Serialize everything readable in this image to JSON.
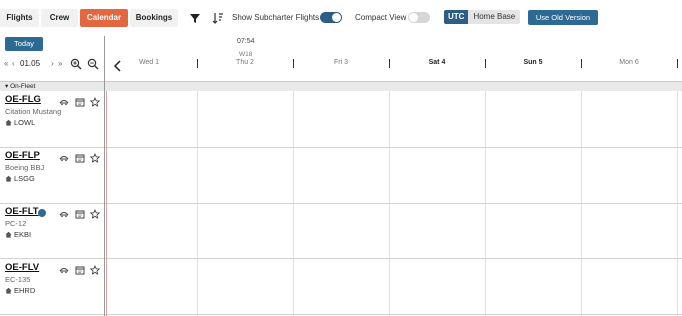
{
  "toolbar": {
    "tabs": [
      {
        "label": "Flights",
        "active": false
      },
      {
        "label": "Crew",
        "active": false
      },
      {
        "label": "Calendar",
        "active": true
      },
      {
        "label": "Bookings",
        "active": false
      }
    ],
    "filter_icon": "filter-icon",
    "sort_icon": "sort-icon",
    "subcharter_label": "Show Subcharter Flights",
    "subcharter_on": true,
    "compact_label": "Compact View",
    "compact_on": false,
    "utc_label": "UTC",
    "home_base_label": "Home Base",
    "old_version_label": "Use Old Version"
  },
  "controls": {
    "today_label": "Today",
    "prev_double": "«",
    "prev": "‹",
    "date": "01.05",
    "next": "›",
    "next_double": "»"
  },
  "timeline": {
    "current_time": "07:54",
    "week": "W18",
    "days": [
      {
        "label": "Wed 1",
        "bold": false
      },
      {
        "label": "Thu 2",
        "bold": false
      },
      {
        "label": "Fri 3",
        "bold": false
      },
      {
        "label": "Sat 4",
        "bold": true
      },
      {
        "label": "Sun 5",
        "bold": true
      },
      {
        "label": "Mon 6",
        "bold": false
      }
    ]
  },
  "section": {
    "label": "On-Fleet"
  },
  "aircraft": [
    {
      "reg": "OE-FLG",
      "type": "Citation Mustang",
      "base": "LOWL",
      "status_dot": false
    },
    {
      "reg": "OE-FLP",
      "type": "Boeing BBJ",
      "base": "LSGG",
      "status_dot": false
    },
    {
      "reg": "OE-FLT",
      "type": "PC-12",
      "base": "EKBI",
      "status_dot": true
    },
    {
      "reg": "OE-FLV",
      "type": "EC-135",
      "base": "EHRD",
      "status_dot": false
    }
  ],
  "colors": {
    "active_tab": "#e3673f",
    "primary": "#2d6a93",
    "toggle_on": "#2d5d85",
    "current_time_line": "#d9a6a6"
  }
}
